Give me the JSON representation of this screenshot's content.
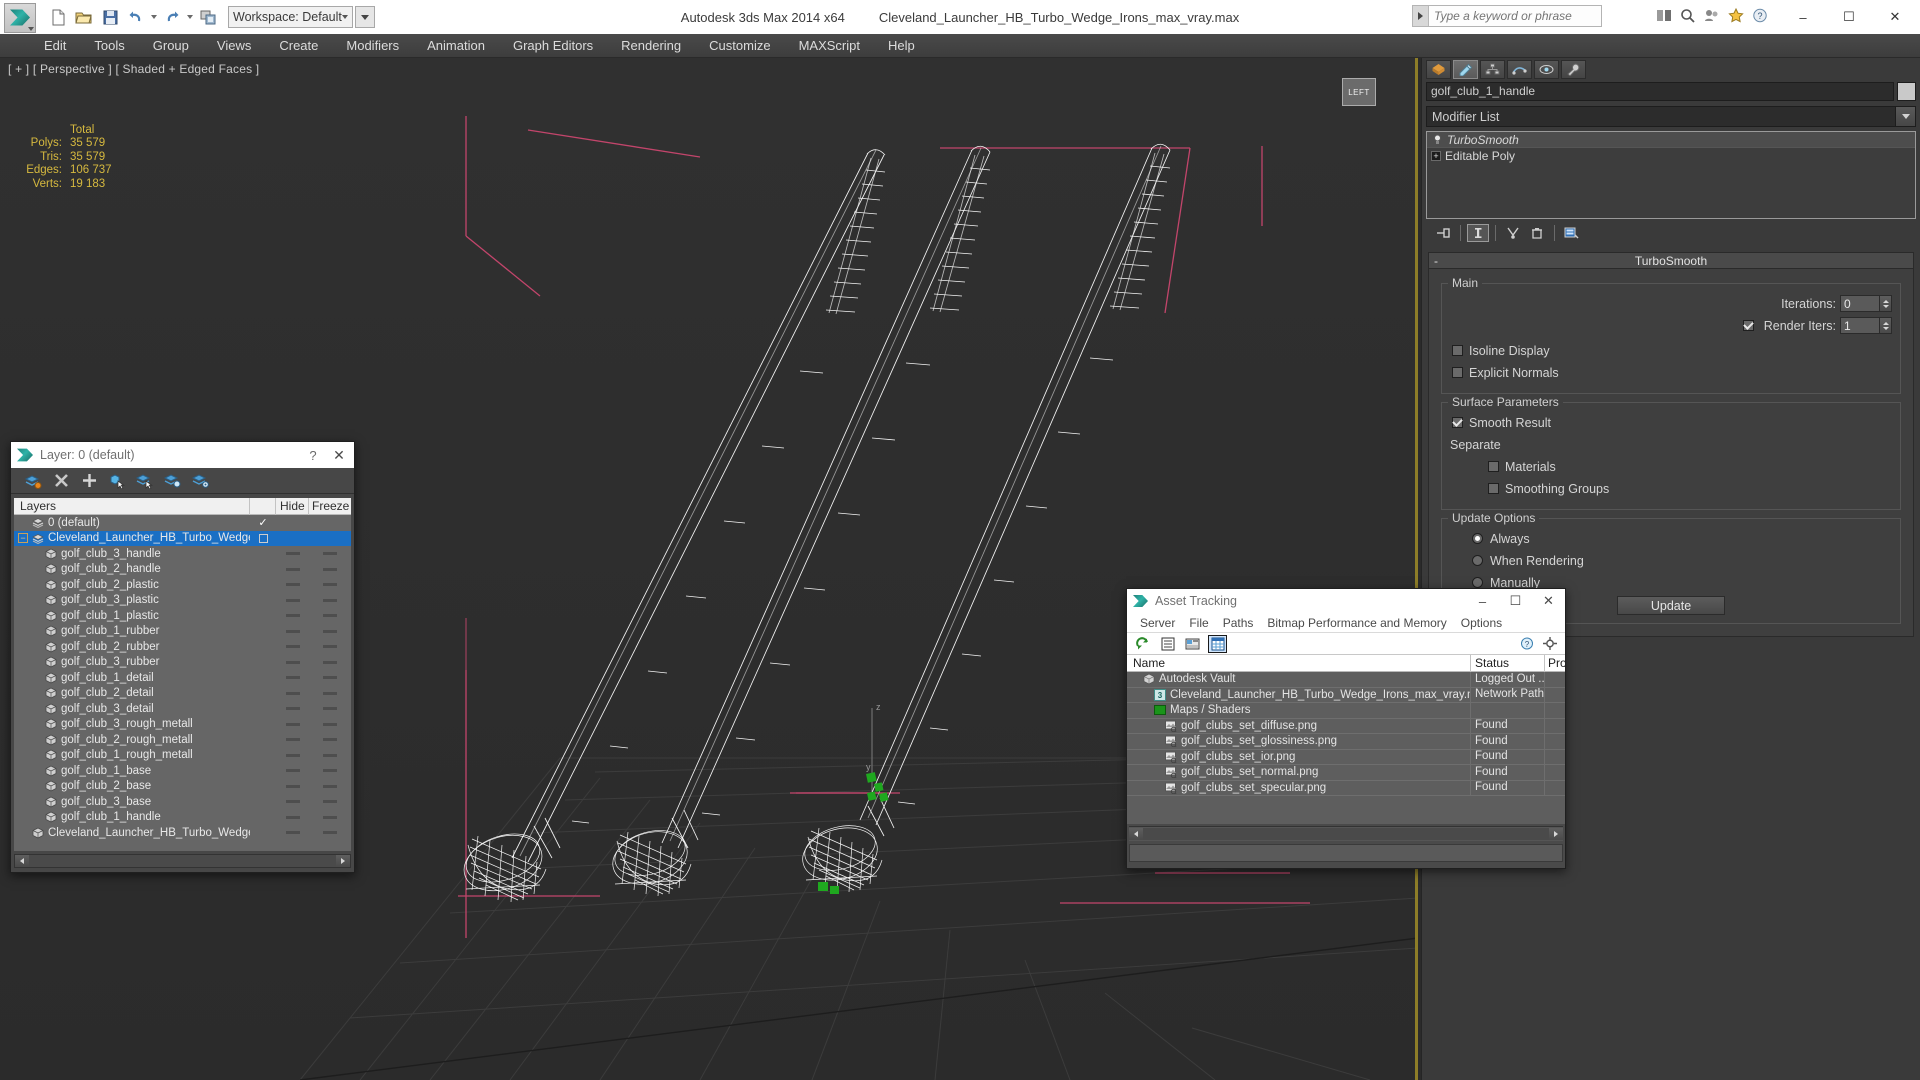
{
  "titlebar": {
    "app_title": "Autodesk 3ds Max  2014 x64",
    "file_title": "Cleveland_Launcher_HB_Turbo_Wedge_Irons_max_vray.max",
    "workspace_label": "Workspace: Default",
    "search_placeholder": "Type a keyword or phrase",
    "minimize": "–",
    "maximize": "☐",
    "close": "✕"
  },
  "menu": {
    "items": [
      "Edit",
      "Tools",
      "Group",
      "Views",
      "Create",
      "Modifiers",
      "Animation",
      "Graph Editors",
      "Rendering",
      "Customize",
      "MAXScript",
      "Help"
    ]
  },
  "viewport": {
    "label": "[ + ] [ Perspective ] [ Shaded + Edged Faces ]",
    "viewcube_label": "LEFT",
    "stats": {
      "header": "Total",
      "rows": [
        {
          "key": "Polys:",
          "value": "35 579"
        },
        {
          "key": "Tris:",
          "value": "35 579"
        },
        {
          "key": "Edges:",
          "value": "106 737"
        },
        {
          "key": "Verts:",
          "value": "19 183"
        }
      ]
    }
  },
  "command_panel": {
    "object_name": "golf_club_1_handle",
    "modifier_list_label": "Modifier List",
    "stack": [
      {
        "label": "TurboSmooth",
        "selected": true
      },
      {
        "label": "Editable Poly",
        "selected": false
      }
    ],
    "rollout": {
      "title": "TurboSmooth",
      "collapse_glyph": "-",
      "main_group": "Main",
      "iterations_label": "Iterations:",
      "iterations_value": "0",
      "render_iters_label": "Render Iters:",
      "render_iters_value": "1",
      "render_iters_checked": true,
      "isoline_display_label": "Isoline Display",
      "isoline_display_checked": false,
      "explicit_normals_label": "Explicit Normals",
      "explicit_normals_checked": false,
      "surface_params_group": "Surface Parameters",
      "smooth_result_label": "Smooth Result",
      "smooth_result_checked": true,
      "separate_label": "Separate",
      "materials_label": "Materials",
      "materials_checked": false,
      "smoothing_groups_label": "Smoothing Groups",
      "smoothing_groups_checked": false,
      "update_options_group": "Update Options",
      "radio_always": "Always",
      "radio_when_rendering": "When Rendering",
      "radio_manually": "Manually",
      "selected_update_option": "Always",
      "update_button": "Update"
    }
  },
  "layer_dialog": {
    "title": "Layer: 0 (default)",
    "help_glyph": "?",
    "close_glyph": "✕",
    "columns": {
      "name": "Layers",
      "hide": "Hide",
      "freeze": "Freeze"
    },
    "rows": [
      {
        "label": "0 (default)",
        "indent": 1,
        "selected": false,
        "expander": false,
        "icon": "layer-icon",
        "check": true,
        "box": false,
        "hide": false,
        "freeze": false
      },
      {
        "label": "Cleveland_Launcher_HB_Turbo_Wedge_Irons",
        "indent": 0,
        "selected": true,
        "expander": true,
        "icon": "layer-icon",
        "check": false,
        "box": true,
        "hide": false,
        "freeze": false
      },
      {
        "label": "golf_club_3_handle",
        "indent": 2,
        "selected": false,
        "expander": false,
        "icon": "object-icon",
        "check": false,
        "box": false,
        "hide": true,
        "freeze": true
      },
      {
        "label": "golf_club_2_handle",
        "indent": 2,
        "selected": false,
        "expander": false,
        "icon": "object-icon",
        "check": false,
        "box": false,
        "hide": true,
        "freeze": true
      },
      {
        "label": "golf_club_2_plastic",
        "indent": 2,
        "selected": false,
        "expander": false,
        "icon": "object-icon",
        "check": false,
        "box": false,
        "hide": true,
        "freeze": true
      },
      {
        "label": "golf_club_3_plastic",
        "indent": 2,
        "selected": false,
        "expander": false,
        "icon": "object-icon",
        "check": false,
        "box": false,
        "hide": true,
        "freeze": true
      },
      {
        "label": "golf_club_1_plastic",
        "indent": 2,
        "selected": false,
        "expander": false,
        "icon": "object-icon",
        "check": false,
        "box": false,
        "hide": true,
        "freeze": true
      },
      {
        "label": "golf_club_1_rubber",
        "indent": 2,
        "selected": false,
        "expander": false,
        "icon": "object-icon",
        "check": false,
        "box": false,
        "hide": true,
        "freeze": true
      },
      {
        "label": "golf_club_2_rubber",
        "indent": 2,
        "selected": false,
        "expander": false,
        "icon": "object-icon",
        "check": false,
        "box": false,
        "hide": true,
        "freeze": true
      },
      {
        "label": "golf_club_3_rubber",
        "indent": 2,
        "selected": false,
        "expander": false,
        "icon": "object-icon",
        "check": false,
        "box": false,
        "hide": true,
        "freeze": true
      },
      {
        "label": "golf_club_1_detail",
        "indent": 2,
        "selected": false,
        "expander": false,
        "icon": "object-icon",
        "check": false,
        "box": false,
        "hide": true,
        "freeze": true
      },
      {
        "label": "golf_club_2_detail",
        "indent": 2,
        "selected": false,
        "expander": false,
        "icon": "object-icon",
        "check": false,
        "box": false,
        "hide": true,
        "freeze": true
      },
      {
        "label": "golf_club_3_detail",
        "indent": 2,
        "selected": false,
        "expander": false,
        "icon": "object-icon",
        "check": false,
        "box": false,
        "hide": true,
        "freeze": true
      },
      {
        "label": "golf_club_3_rough_metall",
        "indent": 2,
        "selected": false,
        "expander": false,
        "icon": "object-icon",
        "check": false,
        "box": false,
        "hide": true,
        "freeze": true
      },
      {
        "label": "golf_club_2_rough_metall",
        "indent": 2,
        "selected": false,
        "expander": false,
        "icon": "object-icon",
        "check": false,
        "box": false,
        "hide": true,
        "freeze": true
      },
      {
        "label": "golf_club_1_rough_metall",
        "indent": 2,
        "selected": false,
        "expander": false,
        "icon": "object-icon",
        "check": false,
        "box": false,
        "hide": true,
        "freeze": true
      },
      {
        "label": "golf_club_1_base",
        "indent": 2,
        "selected": false,
        "expander": false,
        "icon": "object-icon",
        "check": false,
        "box": false,
        "hide": true,
        "freeze": true
      },
      {
        "label": "golf_club_2_base",
        "indent": 2,
        "selected": false,
        "expander": false,
        "icon": "object-icon",
        "check": false,
        "box": false,
        "hide": true,
        "freeze": true
      },
      {
        "label": "golf_club_3_base",
        "indent": 2,
        "selected": false,
        "expander": false,
        "icon": "object-icon",
        "check": false,
        "box": false,
        "hide": true,
        "freeze": true
      },
      {
        "label": "golf_club_1_handle",
        "indent": 2,
        "selected": false,
        "expander": false,
        "icon": "object-icon",
        "check": false,
        "box": false,
        "hide": true,
        "freeze": true
      },
      {
        "label": "Cleveland_Launcher_HB_Turbo_Wedge_Irons",
        "indent": 1,
        "selected": false,
        "expander": false,
        "icon": "object-icon",
        "check": false,
        "box": false,
        "hide": true,
        "freeze": true
      }
    ]
  },
  "asset_tracking": {
    "title": "Asset Tracking",
    "minimize": "–",
    "maximize": "☐",
    "close": "✕",
    "menu": [
      "Server",
      "File",
      "Paths",
      "Bitmap Performance and Memory",
      "Options"
    ],
    "columns": {
      "name": "Name",
      "status": "Status",
      "pro": "Pro"
    },
    "rows": [
      {
        "name": "Autodesk Vault",
        "indent": 1,
        "icon": "vault-icon",
        "status": "Logged Out ..."
      },
      {
        "name": "Cleveland_Launcher_HB_Turbo_Wedge_Irons_max_vray.max",
        "indent": 2,
        "icon": "max-file-icon",
        "status": "Network Path"
      },
      {
        "name": "Maps / Shaders",
        "indent": 2,
        "icon": "maps-icon",
        "status": ""
      },
      {
        "name": "golf_clubs_set_diffuse.png",
        "indent": 3,
        "icon": "bitmap-icon",
        "status": "Found"
      },
      {
        "name": "golf_clubs_set_glossiness.png",
        "indent": 3,
        "icon": "bitmap-icon",
        "status": "Found"
      },
      {
        "name": "golf_clubs_set_ior.png",
        "indent": 3,
        "icon": "bitmap-icon",
        "status": "Found"
      },
      {
        "name": "golf_clubs_set_normal.png",
        "indent": 3,
        "icon": "bitmap-icon",
        "status": "Found"
      },
      {
        "name": "golf_clubs_set_specular.png",
        "indent": 3,
        "icon": "bitmap-icon",
        "status": "Found"
      }
    ]
  },
  "colors": {
    "accent_blue": "#1a6fc4",
    "stats_yellow": "#d6b93f",
    "viewport_bg": "#2e2e2e",
    "panel_bg": "#3a3a3a",
    "grid_pink": "#c2456b",
    "gizmo_green": "#1fa81f"
  }
}
